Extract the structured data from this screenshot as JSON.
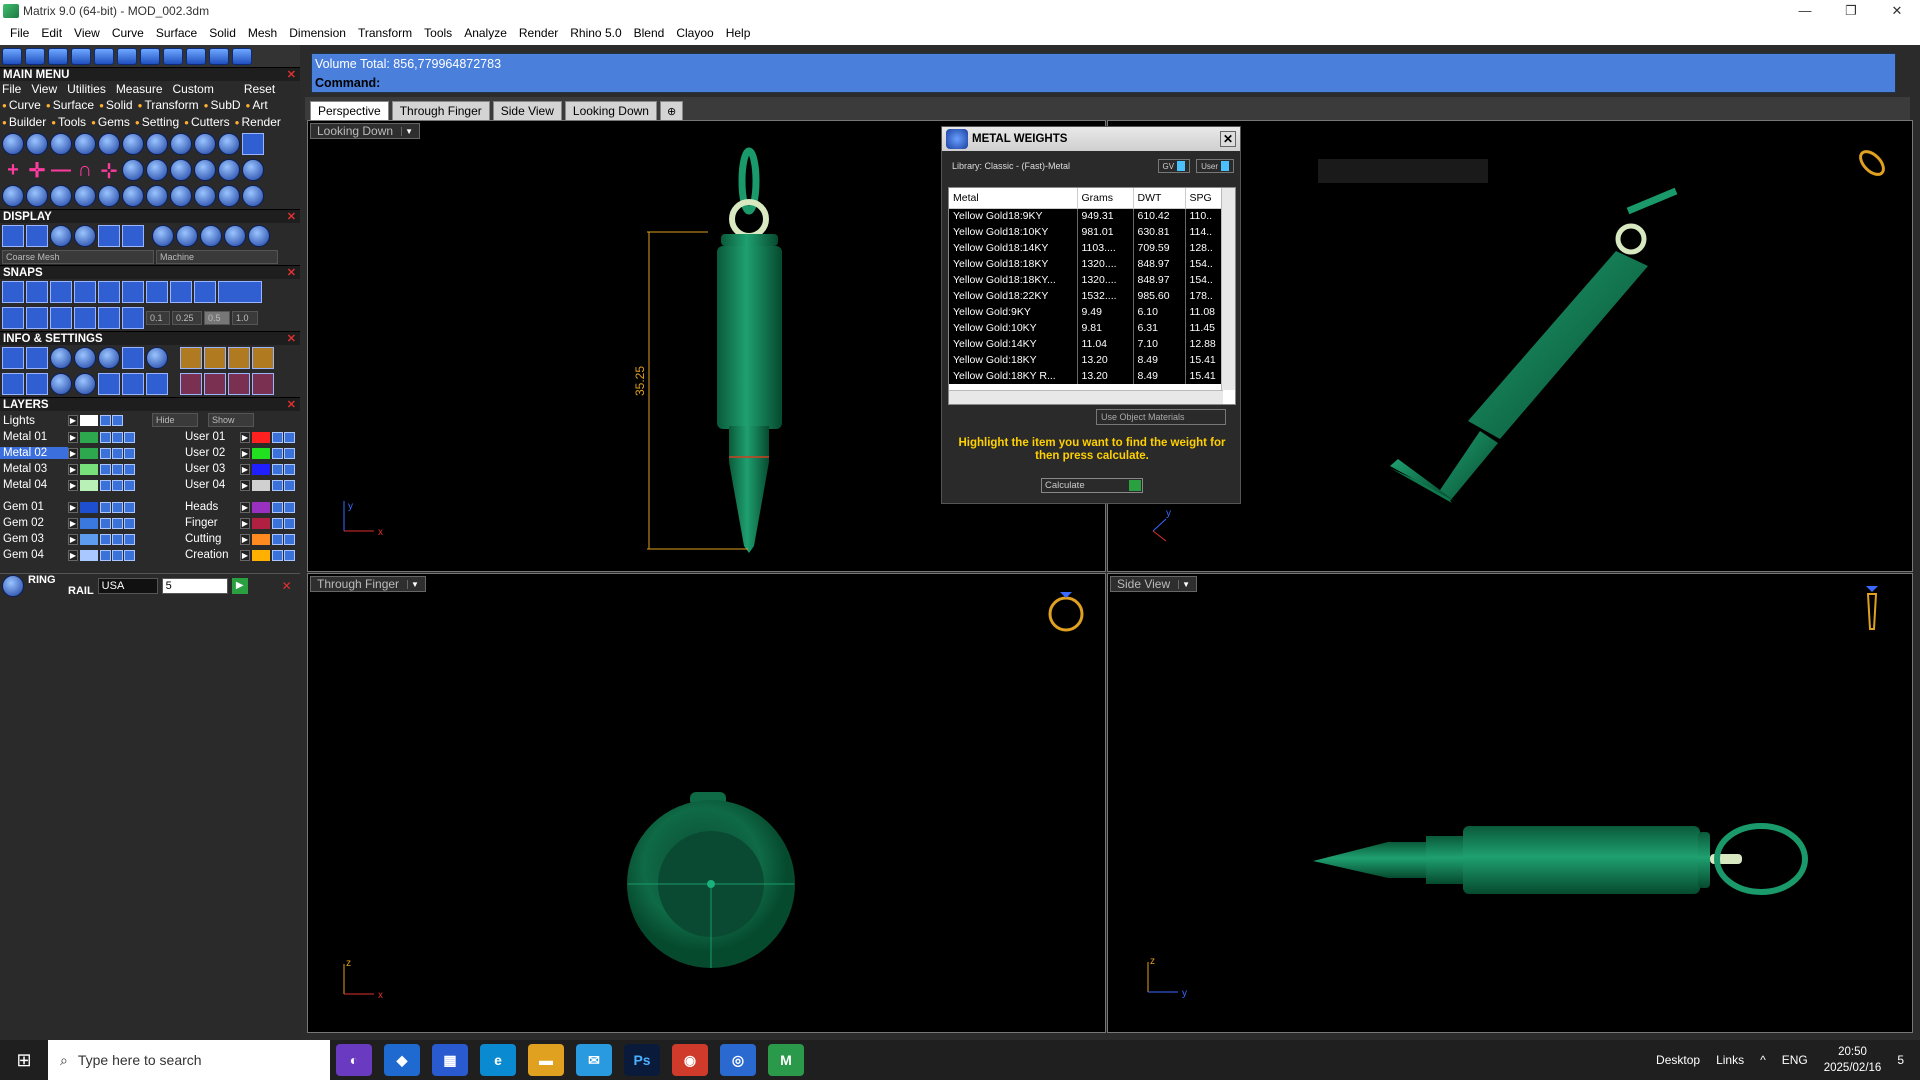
{
  "window": {
    "title": "Matrix 9.0 (64-bit) - MOD_002.3dm",
    "controls": [
      "—",
      "❐",
      "✕"
    ]
  },
  "menubar": [
    "File",
    "Edit",
    "View",
    "Curve",
    "Surface",
    "Solid",
    "Mesh",
    "Dimension",
    "Transform",
    "Tools",
    "Analyze",
    "Render",
    "Rhino 5.0",
    "Blend",
    "Clayoo",
    "Help"
  ],
  "main_menu": {
    "title": "MAIN MENU",
    "items": [
      "File",
      "View",
      "Utilities",
      "Measure",
      "Custom"
    ],
    "reset": "Reset",
    "categories": [
      "Curve",
      "Surface",
      "Solid",
      "Transform",
      "SubD",
      "Art",
      "Builder",
      "Tools",
      "Gems",
      "Setting",
      "Cutters",
      "Render"
    ]
  },
  "display": {
    "title": "DISPLAY",
    "mesh": "Coarse Mesh",
    "material": "Machine"
  },
  "snaps": {
    "title": "SNAPS",
    "values": [
      "0.1",
      "0.25",
      "0.5",
      "1.0"
    ]
  },
  "info": {
    "title": "INFO & SETTINGS"
  },
  "layers": {
    "title": "LAYERS",
    "lights": "Lights",
    "hide": "Hide",
    "show": "Show",
    "left": [
      {
        "name": "Metal 01",
        "color": "#2da84f"
      },
      {
        "name": "Metal 02",
        "color": "#2da84f",
        "selected": true
      },
      {
        "name": "Metal 03",
        "color": "#78e07a"
      },
      {
        "name": "Metal 04",
        "color": "#b8f0b8"
      },
      {
        "name": "Gem 01",
        "color": "#1e4fd0"
      },
      {
        "name": "Gem 02",
        "color": "#3a78e0"
      },
      {
        "name": "Gem 03",
        "color": "#5d9bef"
      },
      {
        "name": "Gem 04",
        "color": "#a8c8ff"
      }
    ],
    "right": [
      {
        "name": "User 01",
        "color": "#ff2020"
      },
      {
        "name": "User 02",
        "color": "#20e020"
      },
      {
        "name": "User 03",
        "color": "#2020ff"
      },
      {
        "name": "User 04",
        "color": "#d0d0d0"
      },
      {
        "name": "Heads",
        "color": "#9a30c0"
      },
      {
        "name": "Finger",
        "color": "#b02040"
      },
      {
        "name": "Cutting",
        "color": "#ff8a20"
      },
      {
        "name": "Creation",
        "color": "#ffb000"
      }
    ]
  },
  "ring_rail": {
    "label1": "RING",
    "label2": "RAIL",
    "region": "USA",
    "size": "5"
  },
  "command": {
    "volume": "Volume Total: 856,779964872783",
    "prompt": "Command:"
  },
  "tabs": [
    "Perspective",
    "Through Finger",
    "Side View",
    "Looking Down",
    "⊕"
  ],
  "viewports": {
    "looking_down": "Looking Down",
    "through_finger": "Through Finger",
    "side_view": "Side View",
    "perspective": "Perspective",
    "dimension": "35.25"
  },
  "metal_weights": {
    "title": "METAL WEIGHTS",
    "library": "Library: Classic - (Fast)-Metal",
    "gv": "GV",
    "user": "User",
    "columns": [
      "Metal",
      "Grams",
      "DWT",
      "SPG"
    ],
    "rows": [
      [
        "Yellow Gold18:9KY",
        "949.31",
        "610.42",
        "110.."
      ],
      [
        "Yellow Gold18:10KY",
        "981.01",
        "630.81",
        "114.."
      ],
      [
        "Yellow Gold18:14KY",
        "1103....",
        "709.59",
        "128.."
      ],
      [
        "Yellow Gold18:18KY",
        "1320....",
        "848.97",
        "154.."
      ],
      [
        "Yellow Gold18:18KY...",
        "1320....",
        "848.97",
        "154.."
      ],
      [
        "Yellow Gold18:22KY",
        "1532....",
        "985.60",
        "178.."
      ],
      [
        "Yellow Gold:9KY",
        "9.49",
        "6.10",
        "11.08"
      ],
      [
        "Yellow Gold:10KY",
        "9.81",
        "6.31",
        "11.45"
      ],
      [
        "Yellow Gold:14KY",
        "11.04",
        "7.10",
        "12.88"
      ],
      [
        "Yellow Gold:18KY",
        "13.20",
        "8.49",
        "15.41"
      ],
      [
        "Yellow Gold:18KY R...",
        "13.20",
        "8.49",
        "15.41"
      ]
    ],
    "use_object": "Use Object Materials",
    "hint": "Highlight the item you want to find the weight for then press calculate.",
    "calculate": "Calculate"
  },
  "taskbar": {
    "search": "Type here to search",
    "desktop": "Desktop",
    "links": "Links",
    "lang": "ENG",
    "time": "20:50",
    "date": "2025/02/16",
    "notif": "5"
  }
}
